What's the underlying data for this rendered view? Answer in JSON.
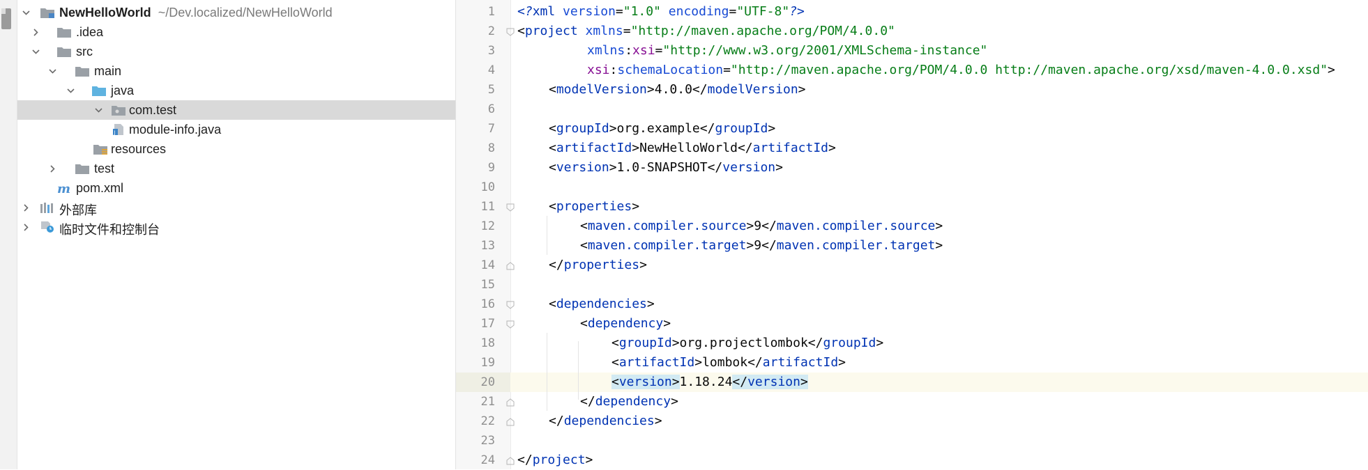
{
  "tree": {
    "project": {
      "name": "NewHelloWorld",
      "path": "~/Dev.localized/NewHelloWorld"
    },
    "items": [
      {
        "label": ".idea"
      },
      {
        "label": "src"
      },
      {
        "label": "main"
      },
      {
        "label": "java"
      },
      {
        "label": "com.test"
      },
      {
        "label": "module-info.java"
      },
      {
        "label": "resources"
      },
      {
        "label": "test"
      },
      {
        "label": "pom.xml"
      },
      {
        "label": "外部库"
      },
      {
        "label": "临时文件和控制台"
      }
    ]
  },
  "editor": {
    "line_numbers": [
      "1",
      "2",
      "3",
      "4",
      "5",
      "6",
      "7",
      "8",
      "9",
      "10",
      "11",
      "12",
      "13",
      "14",
      "15",
      "16",
      "17",
      "18",
      "19",
      "20",
      "21",
      "22",
      "23",
      "24"
    ],
    "xml": {
      "version": "\"1.0\"",
      "encoding": "\"UTF-8\"",
      "xmlns": "\"http://maven.apache.org/POM/4.0.0\"",
      "xsi": "\"http://www.w3.org/2001/XMLSchema-instance\"",
      "schema_location": "\"http://maven.apache.org/POM/4.0.0 http://maven.apache.org/xsd/maven-4.0.0.xsd\"",
      "model_version": "4.0.0",
      "group_id": "org.example",
      "artifact_id": "NewHelloWorld",
      "project_version": "1.0-SNAPSHOT",
      "source": "9",
      "target": "9",
      "dep_group_id": "org.projectlombok",
      "dep_artifact_id": "lombok",
      "dep_version": "1.18.24"
    }
  },
  "colors": {
    "tag": "#0033b3",
    "string": "#067d17",
    "namespace": "#871094",
    "selection": "#d9d9d9",
    "current_line": "#fcfaed"
  }
}
